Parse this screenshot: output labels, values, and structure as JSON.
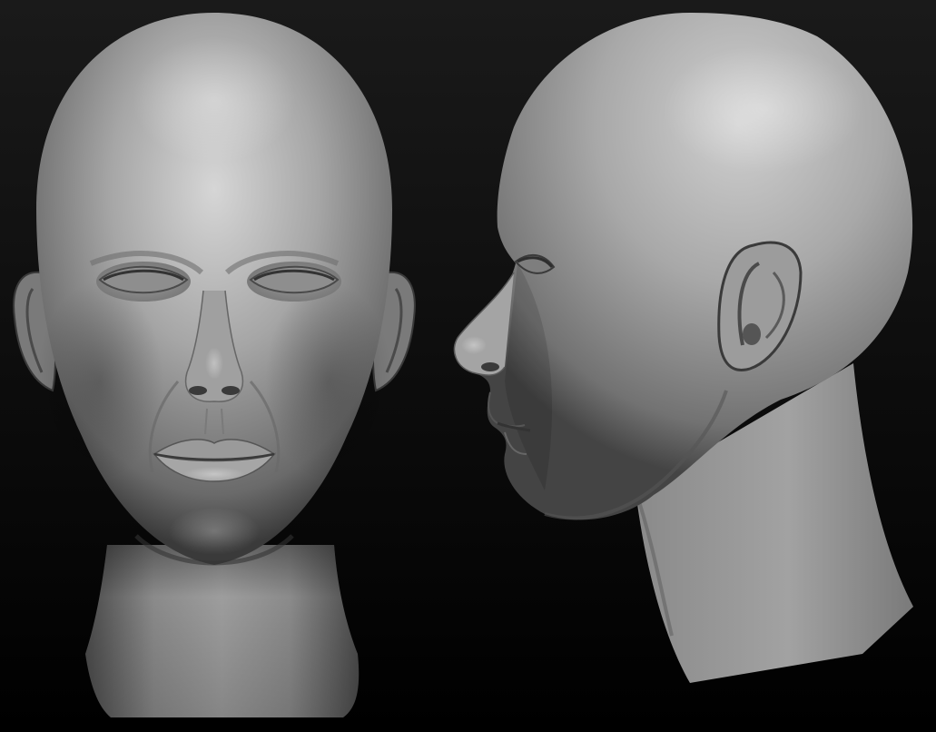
{
  "scene": {
    "background_top": "#151515",
    "background_bottom": "#000000",
    "clay_light": "#d2d2d2",
    "clay_mid": "#8e8e8e",
    "clay_dark": "#3c3c3c",
    "views": [
      {
        "view": "front"
      },
      {
        "view": "side-profile"
      }
    ]
  }
}
